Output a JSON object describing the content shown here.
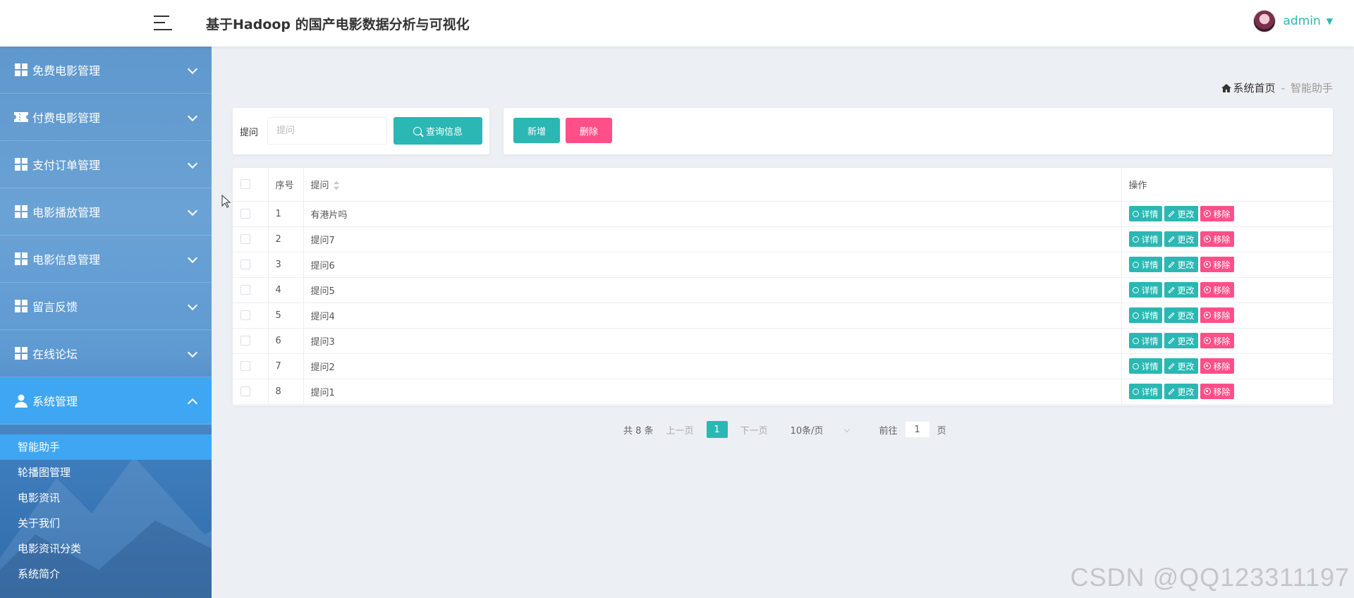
{
  "header": {
    "title": "基于Hadoop 的国产电影数据分析与可视化",
    "user_name": "admin",
    "user_caret": "▼"
  },
  "sidebar": {
    "items": [
      {
        "label": "免费电影管理",
        "icon": "grid-icon",
        "expanded": false
      },
      {
        "label": "付费电影管理",
        "icon": "ticket-icon",
        "expanded": false
      },
      {
        "label": "支付订单管理",
        "icon": "grid-icon",
        "expanded": false
      },
      {
        "label": "电影播放管理",
        "icon": "grid-icon",
        "expanded": false
      },
      {
        "label": "电影信息管理",
        "icon": "grid-icon",
        "expanded": false
      },
      {
        "label": "留言反馈",
        "icon": "grid-icon",
        "expanded": false
      },
      {
        "label": "在线论坛",
        "icon": "grid-icon",
        "expanded": false
      },
      {
        "label": "系统管理",
        "icon": "user-icon",
        "expanded": true
      }
    ],
    "submenu": [
      "智能助手",
      "轮播图管理",
      "电影资讯",
      "关于我们",
      "电影资讯分类",
      "系统简介"
    ],
    "active_submenu": "智能助手"
  },
  "breadcrumb": {
    "home": "系统首页",
    "separator": "-",
    "current": "智能助手"
  },
  "search": {
    "label": "提问",
    "placeholder": "提问",
    "button": "查询信息"
  },
  "actions": {
    "add": "新增",
    "delete": "删除"
  },
  "table": {
    "headers": {
      "seq": "序号",
      "question": "提问",
      "ops": "操作"
    },
    "rows": [
      {
        "seq": "1",
        "question": "有港片吗"
      },
      {
        "seq": "2",
        "question": "提问7"
      },
      {
        "seq": "3",
        "question": "提问6"
      },
      {
        "seq": "4",
        "question": "提问5"
      },
      {
        "seq": "5",
        "question": "提问4"
      },
      {
        "seq": "6",
        "question": "提问3"
      },
      {
        "seq": "7",
        "question": "提问2"
      },
      {
        "seq": "8",
        "question": "提问1"
      }
    ],
    "row_actions": {
      "detail": "详情",
      "edit": "更改",
      "remove": "移除"
    }
  },
  "pagination": {
    "total": "共 8 条",
    "prev": "上一页",
    "current": "1",
    "next": "下一页",
    "page_size": "10条/页",
    "goto_label": "前往",
    "goto_value": "1",
    "goto_suffix": "页"
  },
  "watermark": "CSDN @QQ123311197",
  "colors": {
    "primary": "#2bb7b3",
    "danger": "#ff4f88",
    "sidebar_active": "#3ea6f3"
  }
}
